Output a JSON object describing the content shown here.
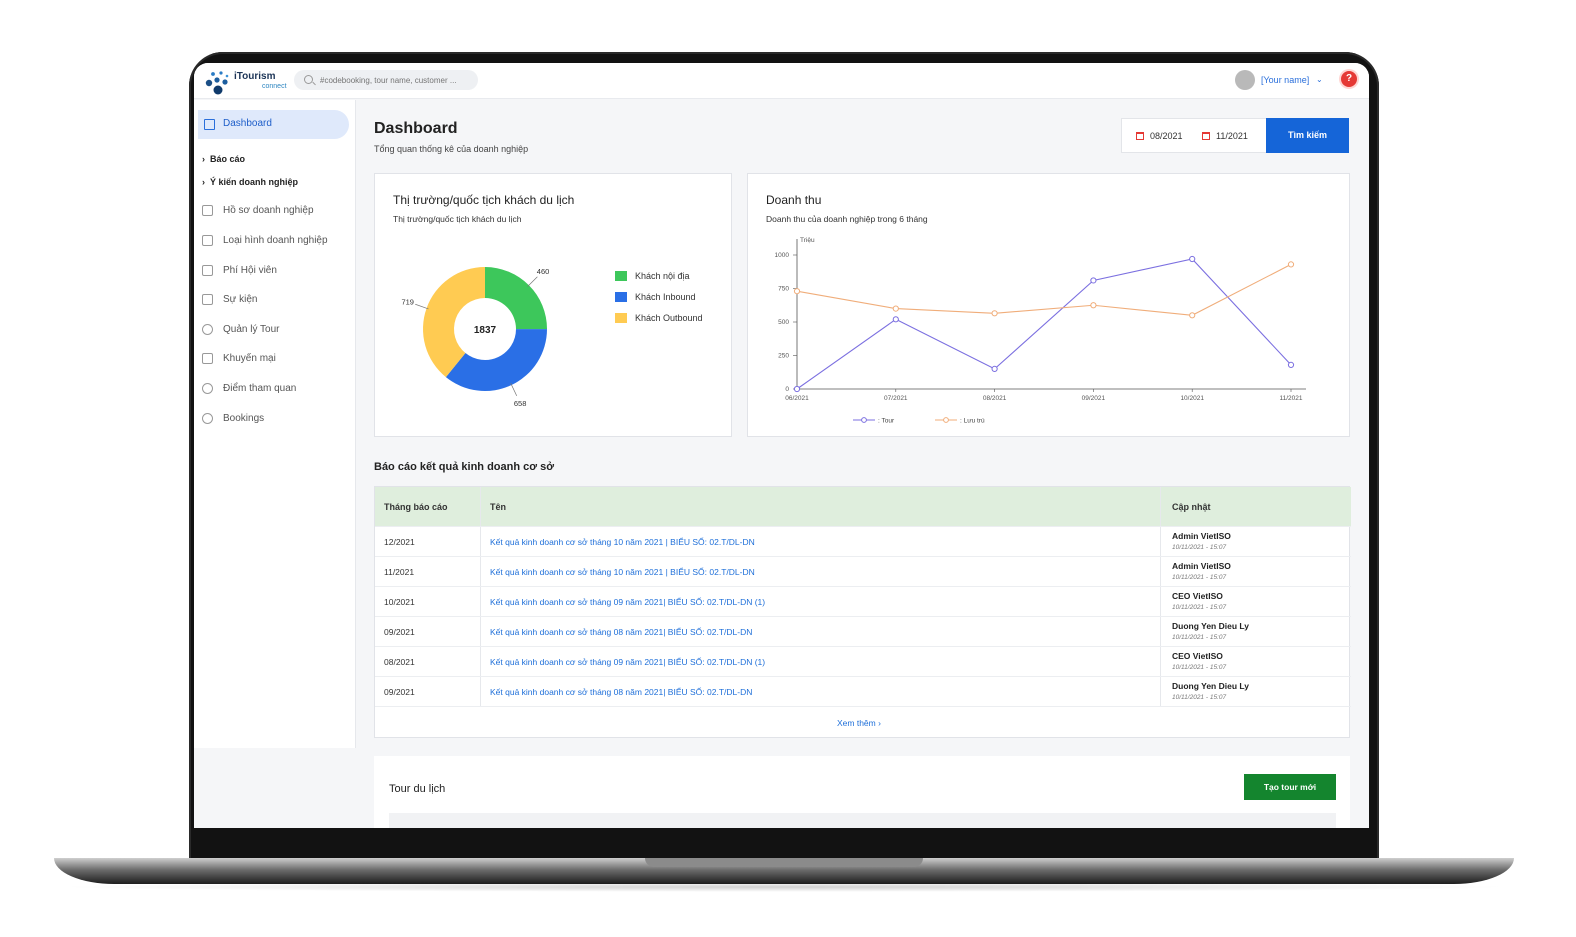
{
  "topbar": {
    "logo_name": "iTourism",
    "logo_sub": "connect",
    "search_placeholder": "#codebooking, tour name, customer ...",
    "user_name": "[Your name]",
    "help_symbol": "?"
  },
  "sidebar": {
    "active": "Dashboard",
    "groups": [
      "Báo cáo",
      "Ý kiến doanh nghiệp"
    ],
    "items": [
      "Hồ sơ doanh nghiệp",
      "Loại hình doanh nghiệp",
      "Phí Hội viên",
      "Sự kiện",
      "Quản lý Tour",
      "Khuyến mại",
      "Điểm tham quan",
      "Bookings"
    ]
  },
  "header": {
    "title": "Dashboard",
    "subtitle": "Tổng quan thống kê của doanh nghiệp",
    "date_from": "08/2021",
    "date_to": "11/2021",
    "search_label": "Tìm kiếm"
  },
  "market_card": {
    "title": "Thị trường/quốc tịch khách du lịch",
    "subtitle": "Thị trường/quốc tịch khách du lịch",
    "total": "1837"
  },
  "revenue_card": {
    "title": "Doanh thu",
    "subtitle": "Doanh thu của doanh nghiệp trong 6 tháng"
  },
  "chart_data": [
    {
      "type": "pie",
      "labels": [
        "Khách nội địa",
        "Khách Inbound",
        "Khách Outbound"
      ],
      "values": [
        460,
        658,
        719
      ],
      "colors": [
        "#3dc75b",
        "#2a6fe6",
        "#ffcb52"
      ],
      "center_label": "1837"
    },
    {
      "type": "line",
      "x": [
        "06/2021",
        "07/2021",
        "08/2021",
        "09/2021",
        "10/2021",
        "11/2021"
      ],
      "ylabel": "Triệu",
      "ylim": [
        0,
        1000
      ],
      "yticks": [
        0,
        250,
        500,
        750,
        1000
      ],
      "series": [
        {
          "name": ": Tour",
          "values": [
            0,
            520,
            150,
            810,
            970,
            180
          ],
          "color": "#7b6fe0"
        },
        {
          "name": ": Lưu trú",
          "values": [
            730,
            600,
            565,
            625,
            550,
            930
          ],
          "color": "#f0ad7a"
        }
      ]
    }
  ],
  "report": {
    "title": "Báo cáo kết quả kinh doanh cơ sở",
    "headers": [
      "Tháng báo cáo",
      "Tên",
      "Cập nhật"
    ],
    "rows": [
      {
        "month": "12/2021",
        "name": "Kết quả kinh doanh cơ sở tháng 10 năm 2021  | BIỂU SỐ: 02.T/DL-DN",
        "user": "Admin VietISO",
        "time": "10/11/2021 - 15:07"
      },
      {
        "month": "11/2021",
        "name": "Kết quả kinh doanh cơ sở tháng 10 năm 2021  | BIỂU SỐ: 02.T/DL-DN",
        "user": "Admin VietISO",
        "time": "10/11/2021 - 15:07"
      },
      {
        "month": "10/2021",
        "name": "Kết quả kinh doanh cơ sở tháng 09 năm 2021| BIỂU SỐ: 02.T/DL-DN (1)",
        "user": "CEO VietISO",
        "time": "10/11/2021 - 15:07"
      },
      {
        "month": "09/2021",
        "name": "Kết quả kinh doanh cơ sở tháng 08 năm 2021| BIỂU SỐ: 02.T/DL-DN",
        "user": "Duong Yen Dieu Ly",
        "time": "10/11/2021 - 15:07"
      },
      {
        "month": "08/2021",
        "name": "Kết quả kinh doanh cơ sở tháng 09 năm 2021| BIỂU SỐ: 02.T/DL-DN (1)",
        "user": "CEO VietISO",
        "time": "10/11/2021 - 15:07"
      },
      {
        "month": "09/2021",
        "name": "Kết quả kinh doanh cơ sở tháng 08 năm 2021| BIỂU SỐ: 02.T/DL-DN",
        "user": "Duong Yen Dieu Ly",
        "time": "10/11/2021 - 15:07"
      }
    ],
    "more_label": "Xem thêm"
  },
  "tour": {
    "title": "Tour du lịch",
    "create_label": "Tạo tour mới"
  }
}
